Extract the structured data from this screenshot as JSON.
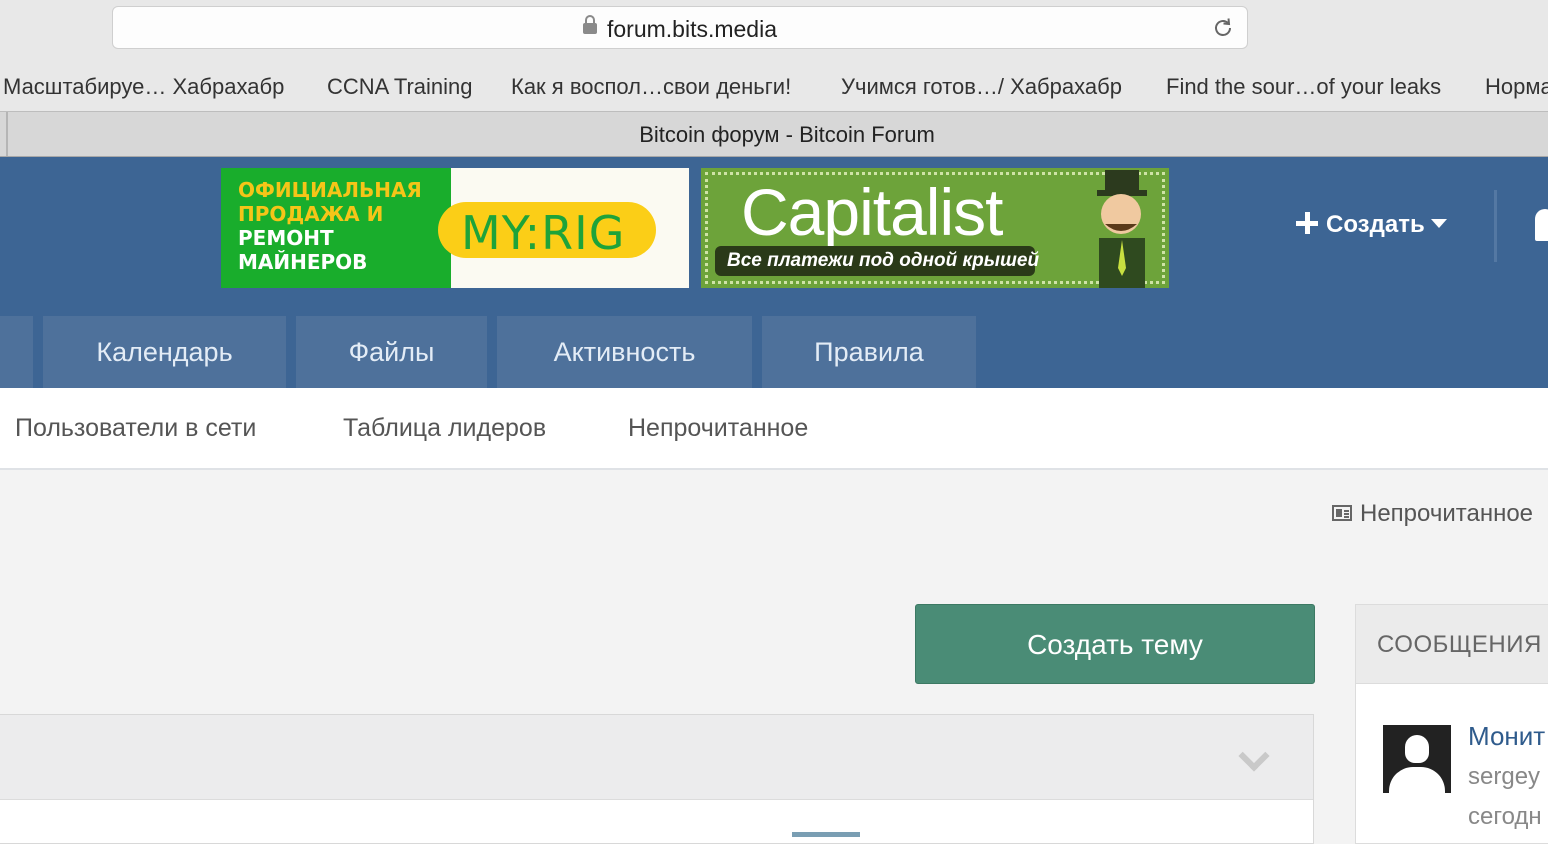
{
  "browser": {
    "url": "forum.bits.media",
    "tab_title": "Bitcoin форум - Bitcoin Forum",
    "bookmarks": [
      "Масштабируе… Хабрахабр",
      "CCNA Training",
      "Как я воспол…свои деньги!",
      "Учимся готов…/ Хабрахабр",
      "Find the sour…of your leaks",
      "Норма"
    ]
  },
  "header": {
    "ad1": {
      "lines": [
        "ОФИЦИАЛЬНАЯ",
        "ПРОДАЖА И",
        "РЕМОНТ",
        "МАЙНЕРОВ"
      ],
      "logo": "MY:RIG"
    },
    "ad2": {
      "logo": "Capitalist",
      "tagline": "Все платежи под одной крышей"
    },
    "create_label": "Создать",
    "nav": [
      "Календарь",
      "Файлы",
      "Активность",
      "Правила"
    ]
  },
  "subnav": [
    "Пользователи в сети",
    "Таблица лидеров",
    "Непрочитанное"
  ],
  "content": {
    "unread_label": "Непрочитанное",
    "new_topic_label": "Создать тему",
    "side_panel": {
      "title": "СООБЩЕНИЯ",
      "post_title": "Монит",
      "author": "sergey",
      "date": "сегодн"
    }
  }
}
